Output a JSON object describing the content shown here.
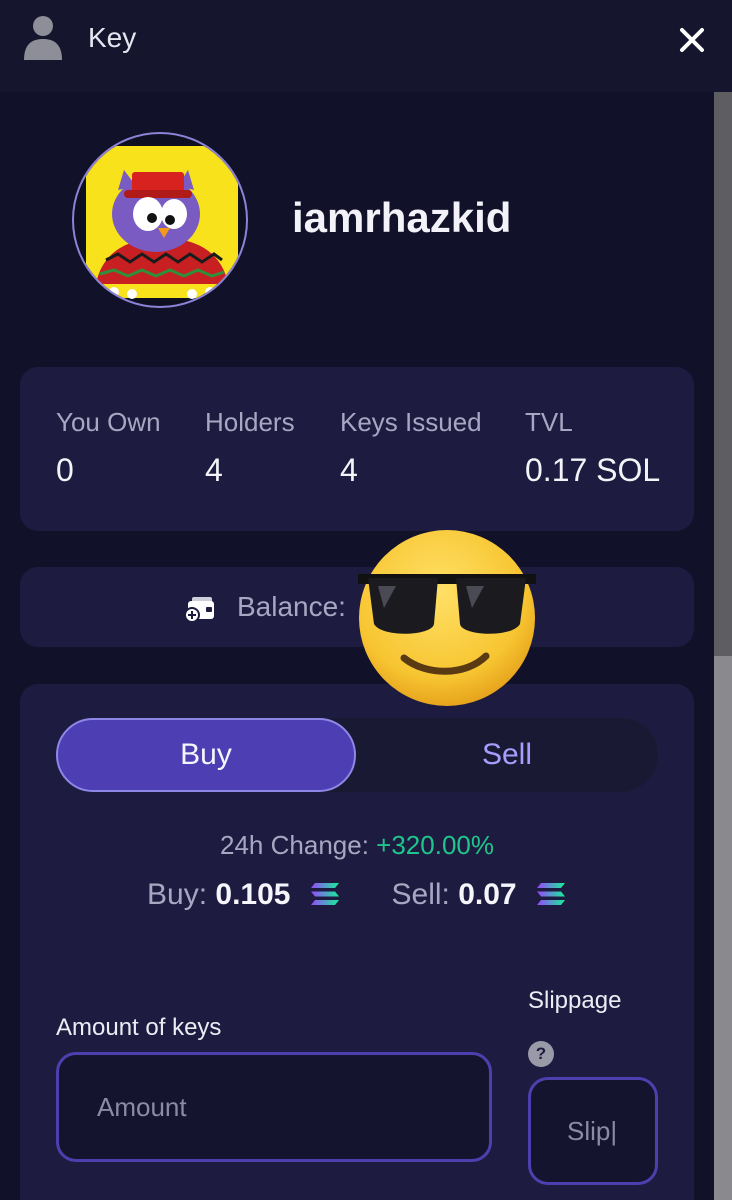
{
  "header": {
    "title": "Key",
    "icon": "user-icon",
    "close_icon": "close-icon"
  },
  "profile": {
    "username": "iamrhazkid",
    "avatar_icon": "owl-avatar"
  },
  "stats": [
    {
      "label": "You Own",
      "value": "0"
    },
    {
      "label": "Holders",
      "value": "4"
    },
    {
      "label": "Keys Issued",
      "value": "4"
    },
    {
      "label": "TVL",
      "value": "0.17 SOL"
    }
  ],
  "balance": {
    "label": "Balance:",
    "icon": "wallet-icon"
  },
  "trade": {
    "tabs": {
      "buy": "Buy",
      "sell": "Sell",
      "selected": "Buy"
    },
    "change_label": "24h Change:",
    "change_value": "+320.00%",
    "buy_label": "Buy:",
    "buy_price": "0.105",
    "sell_label": "Sell:",
    "sell_price": "0.07",
    "currency_icon": "solana-icon",
    "amount_label": "Amount of keys",
    "amount_placeholder": "Amount",
    "slippage_label": "Slippage",
    "help_glyph": "?",
    "slippage_placeholder": "Slip|"
  },
  "overlay": {
    "sticker": "sunglasses-emoji"
  },
  "colors": {
    "accent": "#4d3eb3",
    "positive": "#1fc58a",
    "card": "#1d1c40",
    "background": "#11112a"
  }
}
